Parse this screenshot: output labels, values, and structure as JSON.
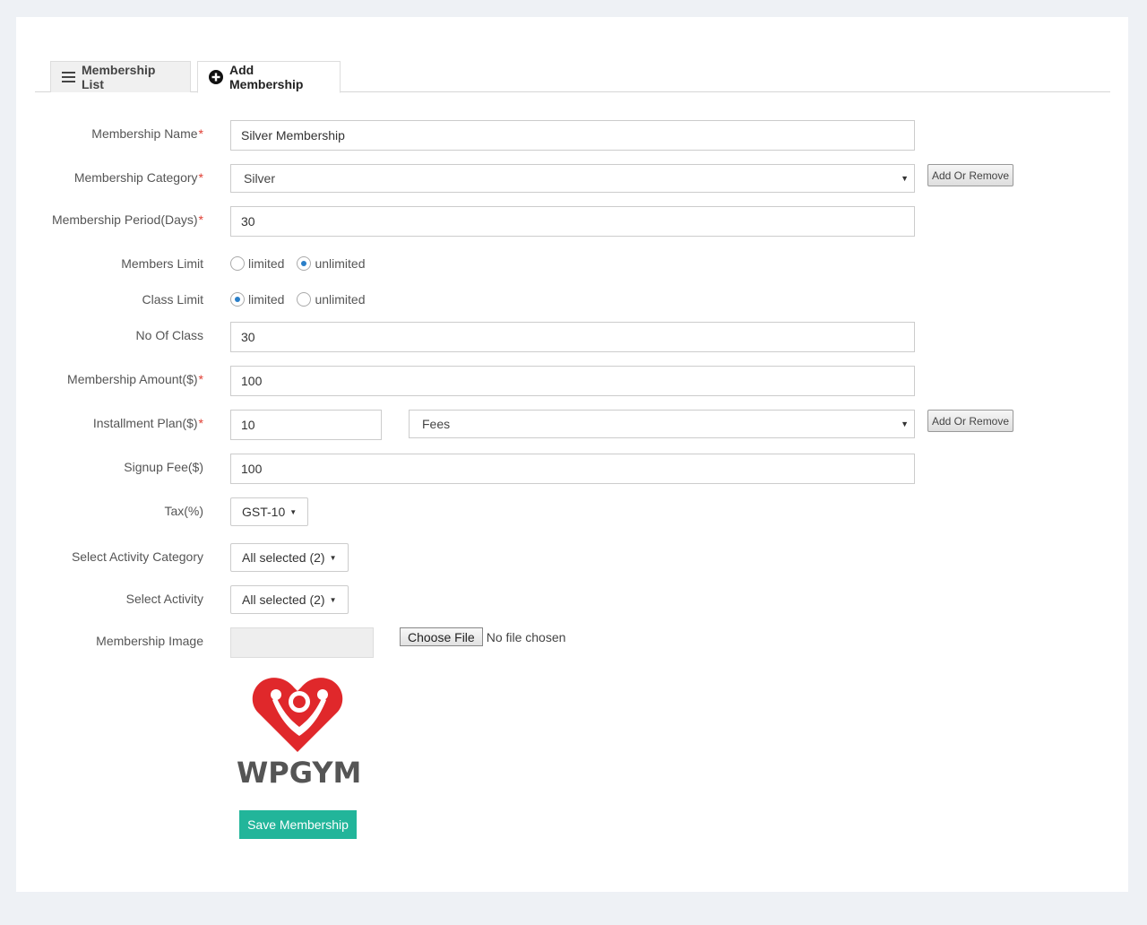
{
  "tabs": [
    {
      "label": "Membership List",
      "icon": "list-icon",
      "active": false
    },
    {
      "label": "Add Membership",
      "icon": "plus-circle-icon",
      "active": true
    }
  ],
  "form": {
    "membership_name": {
      "label": "Membership Name",
      "required": "*",
      "value": "Silver Membership"
    },
    "membership_category": {
      "label": "Membership Category",
      "required": "*",
      "value": "Silver",
      "action": "Add Or Remove"
    },
    "membership_period": {
      "label": "Membership Period(Days)",
      "required": "*",
      "value": "30"
    },
    "members_limit": {
      "label": "Members Limit",
      "options": [
        "limited",
        "unlimited"
      ],
      "selected": "unlimited"
    },
    "class_limit": {
      "label": "Class Limit",
      "options": [
        "limited",
        "unlimited"
      ],
      "selected": "limited"
    },
    "no_of_class": {
      "label": "No Of Class",
      "value": "30"
    },
    "membership_amount": {
      "label": "Membership Amount($)",
      "required": "*",
      "value": "100"
    },
    "installment_plan": {
      "label": "Installment Plan($)",
      "required": "*",
      "value": "10",
      "period": "Fees",
      "action": "Add Or Remove"
    },
    "signup_fee": {
      "label": "Signup Fee($)",
      "value": "100"
    },
    "tax": {
      "label": "Tax(%)",
      "value": "GST-10"
    },
    "activity_category": {
      "label": "Select Activity Category",
      "value": "All selected (2)"
    },
    "activity": {
      "label": "Select Activity",
      "value": "All selected (2)"
    },
    "membership_image": {
      "label": "Membership Image",
      "choose_label": "Choose File",
      "file_status": "No file chosen"
    }
  },
  "logo": {
    "text": "WPGYM",
    "color": "#e0282b"
  },
  "save_button": "Save Membership",
  "colors": {
    "accent": "#22b59a",
    "required": "#e03c31",
    "radio": "#2a7fc8"
  }
}
